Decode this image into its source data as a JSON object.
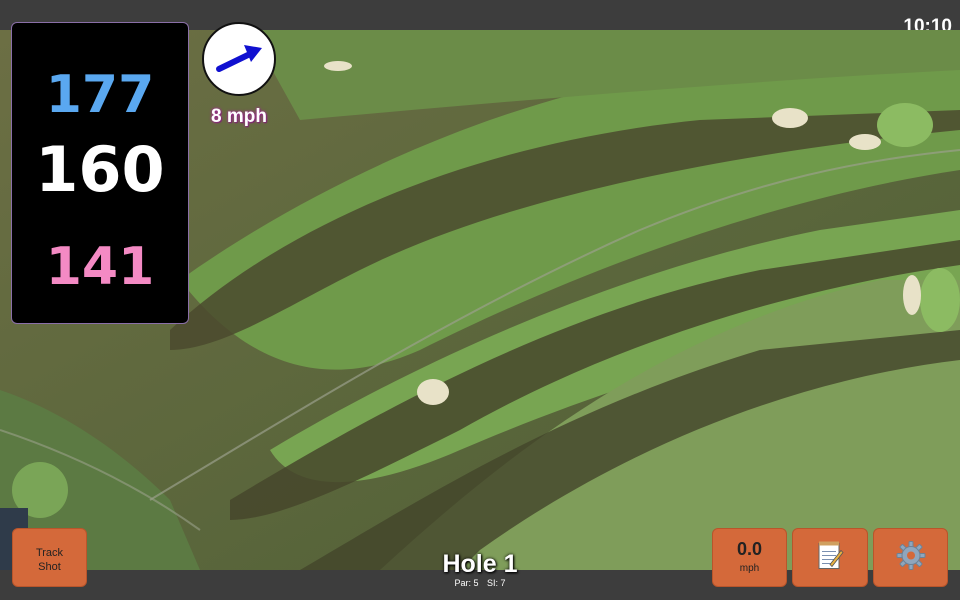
{
  "status_bar": {
    "time": "10:10"
  },
  "distances": {
    "back": "177",
    "middle": "160",
    "front": "141"
  },
  "wind": {
    "speed_label": "8 mph",
    "direction_icon": "wind-arrow-icon"
  },
  "buttons": {
    "track_shot_line1": "Track",
    "track_shot_line2": "Shot",
    "speed_value": "0.0",
    "speed_unit": "mph",
    "notes_icon": "notepad-icon",
    "settings_icon": "gear-icon"
  },
  "hole": {
    "title": "Hole 1",
    "par": "Par: 5",
    "si": "SI: 7"
  },
  "colors": {
    "back_distance": "#5aa8f0",
    "middle_distance": "#ffffff",
    "front_distance": "#f48ac4",
    "button": "#d4693a",
    "wind_arrow": "#1010d0"
  }
}
